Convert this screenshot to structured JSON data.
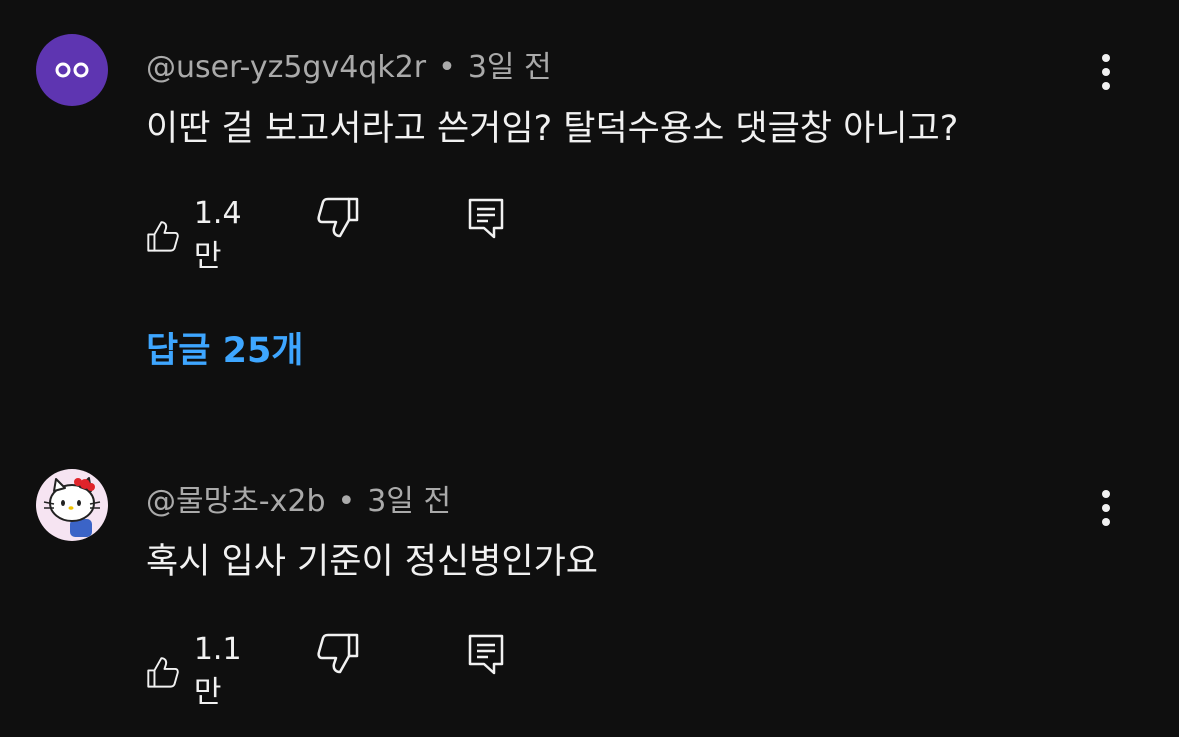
{
  "comments": [
    {
      "author": "@user-yz5gv4qk2r",
      "separator": "•",
      "time": "3일 전",
      "text": "이딴 걸 보고서라고 쓴거임? 탈덕수용소 댓글창 아니고?",
      "likes": "1.4만",
      "avatar_color": "#5e35b1",
      "avatar_icon": "face-eyes-icon"
    },
    {
      "author": "@물망초-x2b",
      "separator": "•",
      "time": "3일 전",
      "text": "혹시 입사 기준이 정신병인가요",
      "likes": "1.1만",
      "avatar_color": "#f6e4f2",
      "avatar_icon": "hello-kitty-icon"
    }
  ],
  "replies_label": "답글 25개",
  "colors": {
    "background": "#0f0f0f",
    "text": "#f1f1f1",
    "meta": "#aaaaaa",
    "link": "#3ea6ff"
  }
}
